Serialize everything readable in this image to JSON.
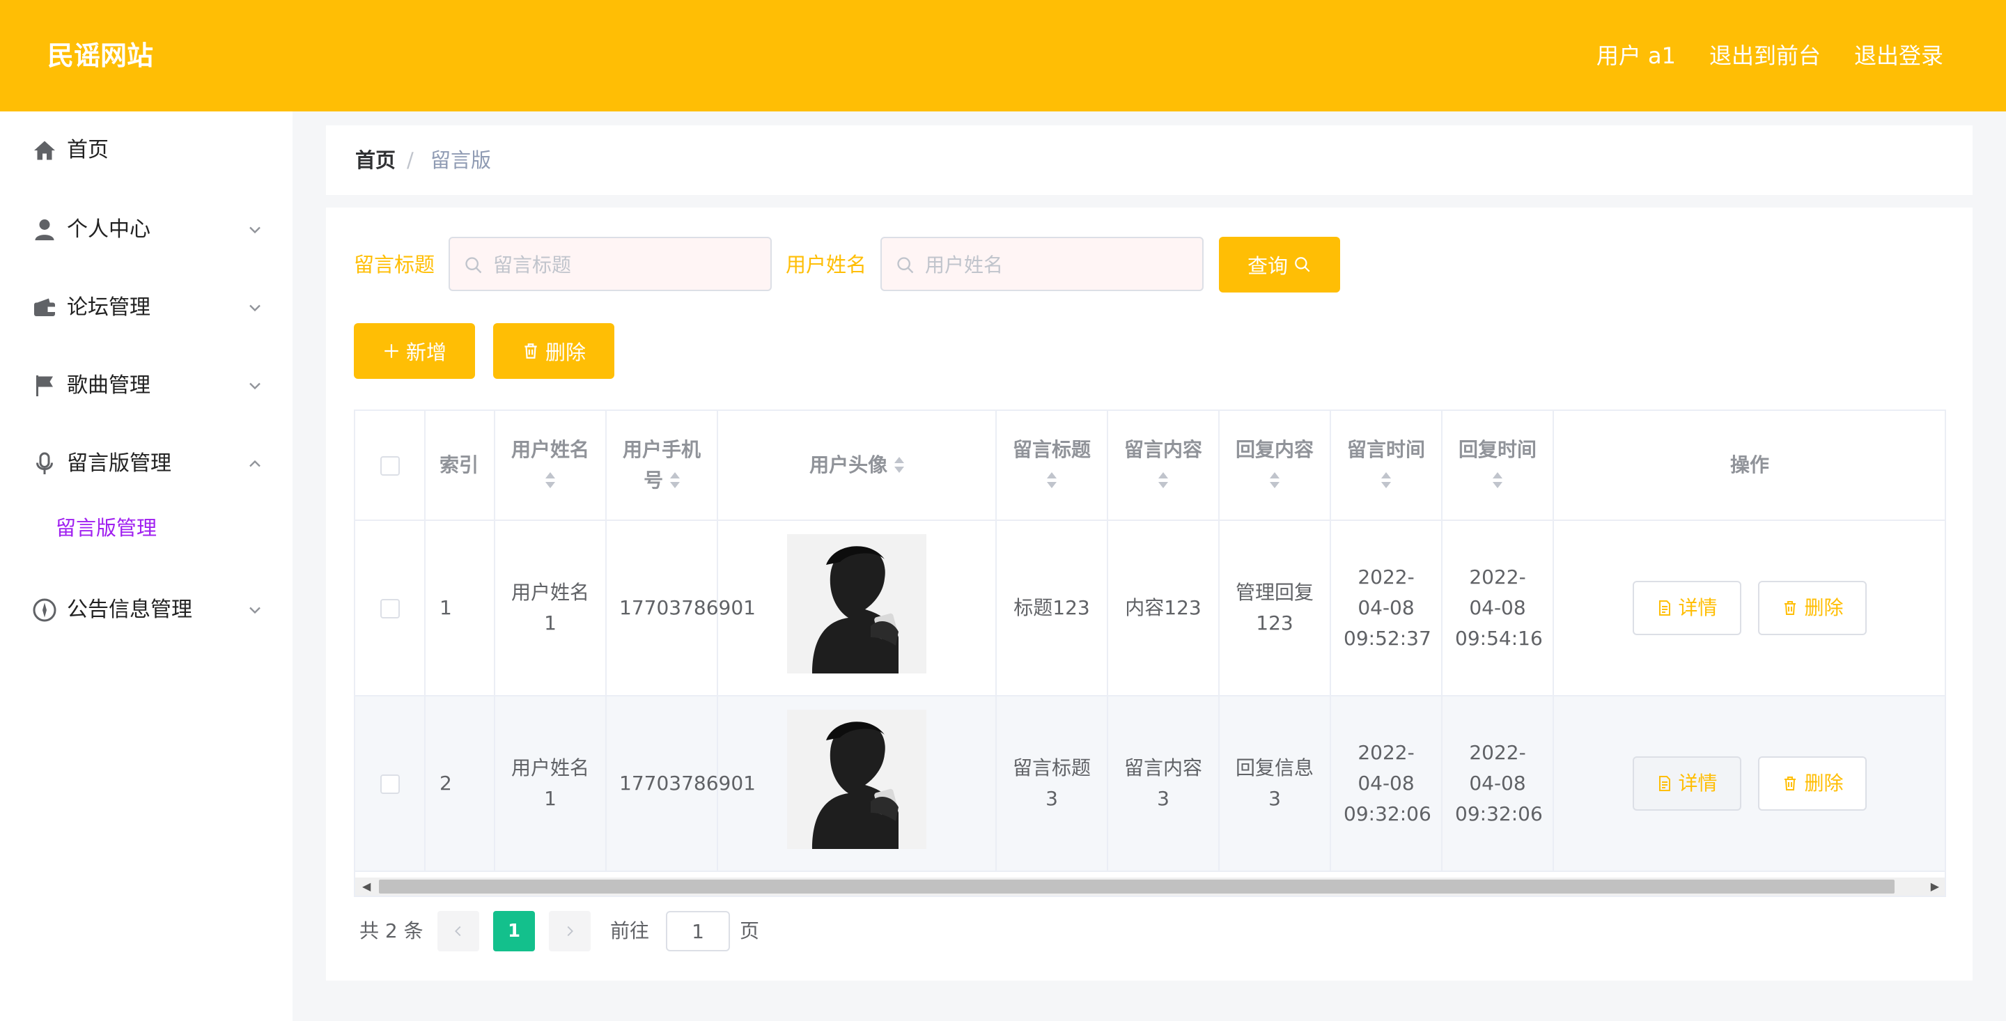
{
  "header": {
    "site_title": "民谣网站",
    "user_label": "用户 a1",
    "to_frontend": "退出到前台",
    "logout": "退出登录"
  },
  "sidebar": {
    "items": [
      {
        "label": "首页",
        "icon": "home-icon"
      },
      {
        "label": "个人中心",
        "icon": "user-icon"
      },
      {
        "label": "论坛管理",
        "icon": "wallet-icon"
      },
      {
        "label": "歌曲管理",
        "icon": "flag-icon"
      },
      {
        "label": "留言版管理",
        "icon": "microphone-icon",
        "expanded": true
      },
      {
        "label": "公告信息管理",
        "icon": "compass-icon"
      }
    ],
    "active_subitem": "留言版管理"
  },
  "breadcrumb": {
    "home": "首页",
    "separator": "/",
    "current": "留言版"
  },
  "filters": {
    "title_label": "留言标题",
    "title_placeholder": "留言标题",
    "user_label": "用户姓名",
    "user_placeholder": "用户姓名",
    "search_button": "查询"
  },
  "actions": {
    "add": "新增",
    "delete": "删除"
  },
  "table": {
    "headers": {
      "index": "索引",
      "user_name": "用户姓名",
      "phone": "用户手机号",
      "avatar": "用户头像",
      "title": "留言标题",
      "content": "留言内容",
      "reply": "回复内容",
      "msg_time": "留言时间",
      "reply_time": "回复时间",
      "ops": "操作"
    },
    "rows": [
      {
        "index": "1",
        "user_name": "用户姓名1",
        "phone": "17703786901",
        "title": "标题123",
        "content": "内容123",
        "reply": "管理回复123",
        "msg_time": "2022-04-08 09:52:37",
        "reply_time": "2022-04-08 09:54:16"
      },
      {
        "index": "2",
        "user_name": "用户姓名1",
        "phone": "17703786901",
        "title": "留言标题3",
        "content": "留言内容3",
        "reply": "回复信息3",
        "msg_time": "2022-04-08 09:32:06",
        "reply_time": "2022-04-08 09:32:06"
      }
    ],
    "detail_label": "详情",
    "delete_label": "删除"
  },
  "pagination": {
    "total": "共 2 条",
    "current_page": "1",
    "goto_label": "前往",
    "goto_value": "1",
    "page_word": "页"
  },
  "colors": {
    "primary": "#ffbe05",
    "active_submenu": "#a020f0",
    "page_active": "#13c08c"
  }
}
